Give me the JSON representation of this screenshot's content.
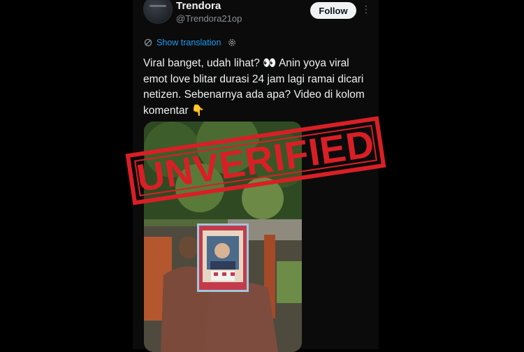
{
  "account": {
    "name": "Trendora",
    "handle": "@Trendora21op",
    "follow_label": "Follow",
    "more_icon": "more-vertical-icon"
  },
  "translation": {
    "label": "Show translation",
    "icon": "globe-icon",
    "settings_icon": "gear-icon"
  },
  "tweet": {
    "text": "Viral banget, udah lihat? 👀 Anin yoya viral emot love blitar durasi 24 jam lagi ramai dicari netizen. Sebenarnya ada apa? Video di kolom komentar 👇"
  },
  "overlay": {
    "stamp_text": "UNVERIFIED",
    "stamp_color": "#d91f26"
  },
  "colors": {
    "link": "#1d9bf0",
    "background": "#000000"
  }
}
